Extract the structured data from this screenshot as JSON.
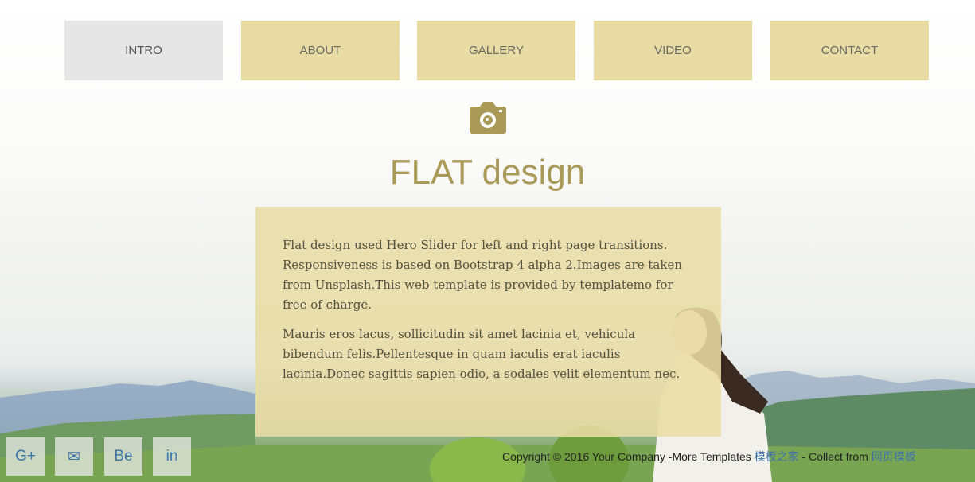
{
  "nav": {
    "items": [
      {
        "label": "INTRO",
        "active": true
      },
      {
        "label": "ABOUT",
        "active": false
      },
      {
        "label": "GALLERY",
        "active": false
      },
      {
        "label": "VIDEO",
        "active": false
      },
      {
        "label": "CONTACT",
        "active": false
      }
    ]
  },
  "hero": {
    "icon": "camera-icon",
    "title": "FLAT design"
  },
  "panel": {
    "paragraph1": "Flat design used Hero Slider for left and right page transitions. Responsiveness is based on Bootstrap 4 alpha 2.Images are taken from Unsplash.This web template is provided by templatemo for free of charge.",
    "paragraph2": "Mauris eros lacus, sollicitudin sit amet lacinia et, vehicula bibendum felis.Pellentesque in quam iaculis erat iaculis lacinia.Donec sagittis sapien odio, a sodales velit elementum nec."
  },
  "social": [
    {
      "label": "G+",
      "icon": "google-plus-icon"
    },
    {
      "label": "✉",
      "icon": "email-icon"
    },
    {
      "label": "Be",
      "icon": "behance-icon"
    },
    {
      "label": "in",
      "icon": "linkedin-icon"
    }
  ],
  "footer": {
    "text1": "Copyright © 2016 Your Company -More Templates ",
    "link1": "模板之家",
    "text2": " - Collect from ",
    "link2": "网页模板"
  },
  "colors": {
    "accent": "#a99a58",
    "nav_bg": "#e8dca4",
    "nav_active_bg": "#e6e6e6",
    "link": "#3f74a8"
  }
}
